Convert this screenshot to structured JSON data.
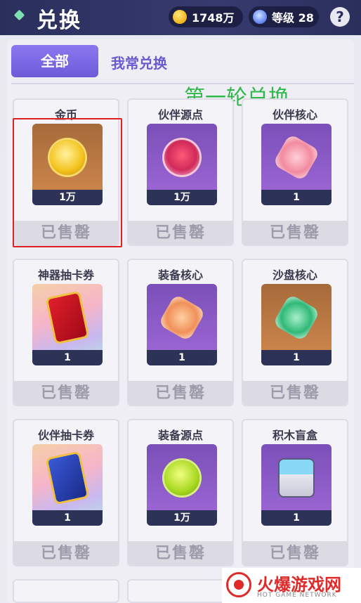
{
  "header": {
    "title": "兑换",
    "coins": "1748万",
    "level": "等级 28",
    "help": "?"
  },
  "tabs": [
    {
      "label": "全部"
    },
    {
      "label": "我常兑换"
    }
  ],
  "annotation": "第一轮兑换",
  "sold_label": "已售罄",
  "items": [
    {
      "name": "金币",
      "qty": "1万"
    },
    {
      "name": "伙伴源点",
      "qty": "1万"
    },
    {
      "name": "伙伴核心",
      "qty": "1"
    },
    {
      "name": "神器抽卡券",
      "qty": "1"
    },
    {
      "name": "装备核心",
      "qty": "1"
    },
    {
      "name": "沙盘核心",
      "qty": "1"
    },
    {
      "name": "伙伴抽卡券",
      "qty": "1"
    },
    {
      "name": "装备源点",
      "qty": "1万"
    },
    {
      "name": "积木盲盒",
      "qty": "1"
    }
  ],
  "watermark": {
    "name": "火爆游戏网",
    "sub": "HOT GAME NETWORK"
  }
}
